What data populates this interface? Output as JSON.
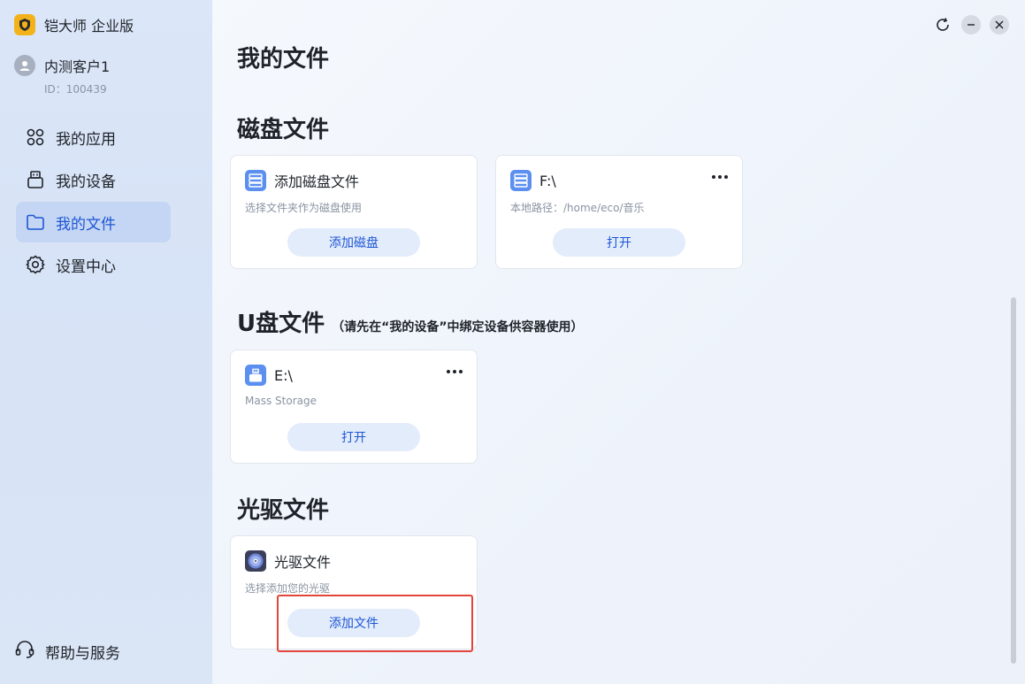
{
  "app": {
    "title": "铠大师 企业版"
  },
  "user": {
    "name": "内测客户1",
    "id": "ID：100439"
  },
  "nav": {
    "items": [
      {
        "label": "我的应用",
        "icon": "apps-icon"
      },
      {
        "label": "我的设备",
        "icon": "device-icon"
      },
      {
        "label": "我的文件",
        "icon": "folder-icon",
        "active": true
      },
      {
        "label": "设置中心",
        "icon": "gear-icon"
      }
    ],
    "help_label": "帮助与服务"
  },
  "page": {
    "title": "我的文件"
  },
  "disk": {
    "title": "磁盘文件",
    "cards": [
      {
        "title": "添加磁盘文件",
        "sub": "选择文件夹作为磁盘使用",
        "button": "添加磁盘"
      },
      {
        "title": "F:\\",
        "sub": "本地路径：/home/eco/音乐",
        "button": "打开"
      }
    ]
  },
  "usb": {
    "title": "U盘文件",
    "note": "（请先在“我的设备”中绑定设备供容器使用）",
    "cards": [
      {
        "title": "E:\\",
        "sub": "Mass Storage",
        "button": "打开"
      }
    ]
  },
  "optical": {
    "title": "光驱文件",
    "cards": [
      {
        "title": "光驱文件",
        "sub": "选择添加您的光驱",
        "button": "添加文件"
      }
    ]
  },
  "colors": {
    "accent": "#1d56d4",
    "highlight": "#e2453c",
    "active_nav": "#c5d6f4"
  }
}
